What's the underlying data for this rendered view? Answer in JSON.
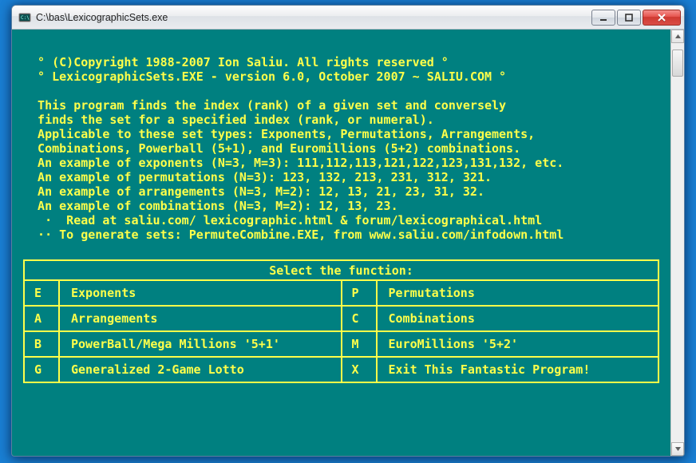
{
  "window": {
    "title": "C:\\bas\\LexicographicSets.exe"
  },
  "console": {
    "lines": [
      "  ° (C)Copyright 1988-2007 Ion Saliu. All rights reserved °",
      "  ° LexicographicSets.EXE - version 6.0, October 2007 ~ SALIU.COM °",
      "",
      "  This program finds the index (rank) of a given set and conversely",
      "  finds the set for a specified index (rank, or numeral).",
      "  Applicable to these set types: Exponents, Permutations, Arrangements,",
      "  Combinations, Powerball (5+1), and Euromillions (5+2) combinations.",
      "  An example of exponents (N=3, M=3): 111,112,113,121,122,123,131,132, etc.",
      "  An example of permutations (N=3): 123, 132, 213, 231, 312, 321.",
      "  An example of arrangements (N=3, M=2): 12, 13, 21, 23, 31, 32.",
      "  An example of combinations (N=3, M=2): 12, 13, 23.",
      "   ·  Read at saliu.com/ lexicographic.html & forum/lexicographical.html",
      "  ·· To generate sets: PermuteCombine.EXE, from www.saliu.com/infodown.html"
    ]
  },
  "menu": {
    "header": "Select the function:",
    "left": [
      {
        "key": "E",
        "label": "Exponents"
      },
      {
        "key": "A",
        "label": "Arrangements"
      },
      {
        "key": "B",
        "label": "PowerBall/Mega Millions '5+1'"
      },
      {
        "key": "G",
        "label": "Generalized 2-Game Lotto"
      }
    ],
    "right": [
      {
        "key": "P",
        "label": "Permutations"
      },
      {
        "key": "C",
        "label": "Combinations"
      },
      {
        "key": "M",
        "label": "EuroMillions '5+2'"
      },
      {
        "key": "X",
        "label": "Exit This Fantastic Program!"
      }
    ]
  },
  "colors": {
    "console_bg": "#008080",
    "console_fg": "#ffff4a"
  }
}
